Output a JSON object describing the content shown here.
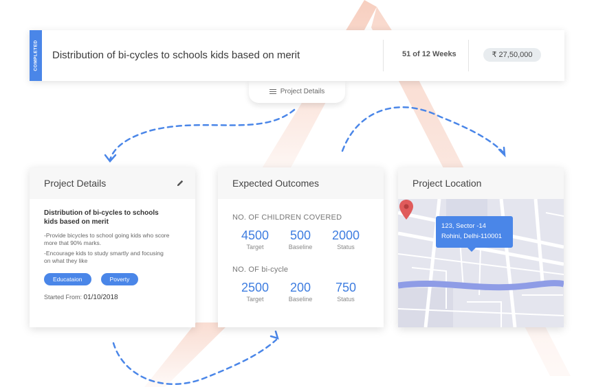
{
  "banner": {
    "status": "COMPLETED",
    "title": "Distribution of bi-cycles to schools kids based on merit",
    "weeks": "51 of 12 Weeks",
    "budget": "₹ 27,50,000"
  },
  "details_tab": {
    "label": "Project Details",
    "icon": "hamburger-icon"
  },
  "project_details": {
    "heading": "Project Details",
    "edit_icon": "pencil-icon",
    "title": "Distribution of bi-cycles to schools kids based on merit",
    "points": [
      "-Provide bicycles to school going kids who score more that 90% marks.",
      "-Encourage kids to study smartly and focusing on what they like"
    ],
    "tags": [
      "Educataion",
      "Poverty"
    ],
    "started_label": "Started From:",
    "started_date": "01/10/2018"
  },
  "outcomes": {
    "heading": "Expected Outcomes",
    "sections": [
      {
        "title": "NO. OF CHILDREN COVERED",
        "metrics": [
          {
            "value": "4500",
            "label": "Target"
          },
          {
            "value": "500",
            "label": "Baseline"
          },
          {
            "value": "2000",
            "label": "Status"
          }
        ]
      },
      {
        "title": "NO. OF bi-cycle",
        "metrics": [
          {
            "value": "2500",
            "label": "Target"
          },
          {
            "value": "200",
            "label": "Baseline"
          },
          {
            "value": "750",
            "label": "Status"
          }
        ]
      }
    ]
  },
  "location": {
    "heading": "Project Location",
    "address_line1": "123, Sector -14",
    "address_line2": "Rohini, Delhi-110001",
    "pin_icon": "map-pin-icon"
  },
  "colors": {
    "accent": "#4a86e8",
    "logo": "#f3b9a6",
    "pin": "#e05b5b"
  }
}
